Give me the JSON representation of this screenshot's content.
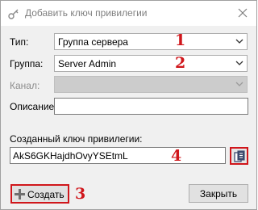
{
  "window": {
    "title": "Добавить ключ привилегии"
  },
  "form": {
    "type_label": "Тип:",
    "type_value": "Группа сервера",
    "group_label": "Группа:",
    "group_value": "Server Admin",
    "channel_label": "Канал:",
    "channel_value": "",
    "description_label": "Описание:",
    "description_value": "",
    "key_label": "Созданный ключ привилегии:",
    "key_value": "AkS6GKHajdhOvyYSEtmL"
  },
  "buttons": {
    "create": "Создать",
    "close": "Закрыть"
  },
  "annotations": {
    "m1": "1",
    "m2": "2",
    "m3": "3",
    "m4": "4"
  },
  "colors": {
    "annotation_red": "#d0161b"
  },
  "icons": [
    "key-privilege-icon",
    "close-icon",
    "chevron-down-icon",
    "copy-icon",
    "plus-icon"
  ]
}
